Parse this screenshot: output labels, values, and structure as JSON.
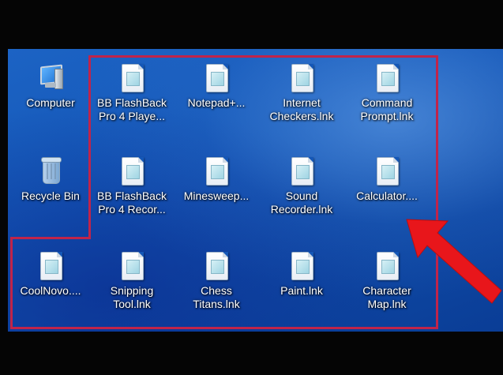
{
  "desktop": {
    "icons": [
      {
        "label": "Computer",
        "icon": "computer-icon"
      },
      {
        "label": "Recycle Bin",
        "icon": "recycle-bin-icon"
      },
      {
        "label": "BB FlashBack\nPro 4 Playe...",
        "icon": "shortcut-file-icon"
      },
      {
        "label": "Notepad+...",
        "icon": "shortcut-file-icon"
      },
      {
        "label": "Internet\nCheckers.lnk",
        "icon": "shortcut-file-icon"
      },
      {
        "label": "Command\nPrompt.lnk",
        "icon": "shortcut-file-icon"
      },
      {
        "label": "BB FlashBack\nPro 4 Recor...",
        "icon": "shortcut-file-icon"
      },
      {
        "label": "Minesweep...",
        "icon": "shortcut-file-icon"
      },
      {
        "label": "Sound\nRecorder.lnk",
        "icon": "shortcut-file-icon"
      },
      {
        "label": "Calculator....",
        "icon": "shortcut-file-icon"
      },
      {
        "label": "CoolNovo....",
        "icon": "shortcut-file-icon"
      },
      {
        "label": "Snipping\nTool.lnk",
        "icon": "shortcut-file-icon"
      },
      {
        "label": "Chess\nTitans.lnk",
        "icon": "shortcut-file-icon"
      },
      {
        "label": "Paint.lnk",
        "icon": "shortcut-file-icon"
      },
      {
        "label": "Character\nMap.lnk",
        "icon": "shortcut-file-icon"
      }
    ]
  },
  "colors": {
    "desktop_blue": "#1457b7",
    "selection_outline": "#c0244a",
    "arrow_red": "#e8161b"
  }
}
